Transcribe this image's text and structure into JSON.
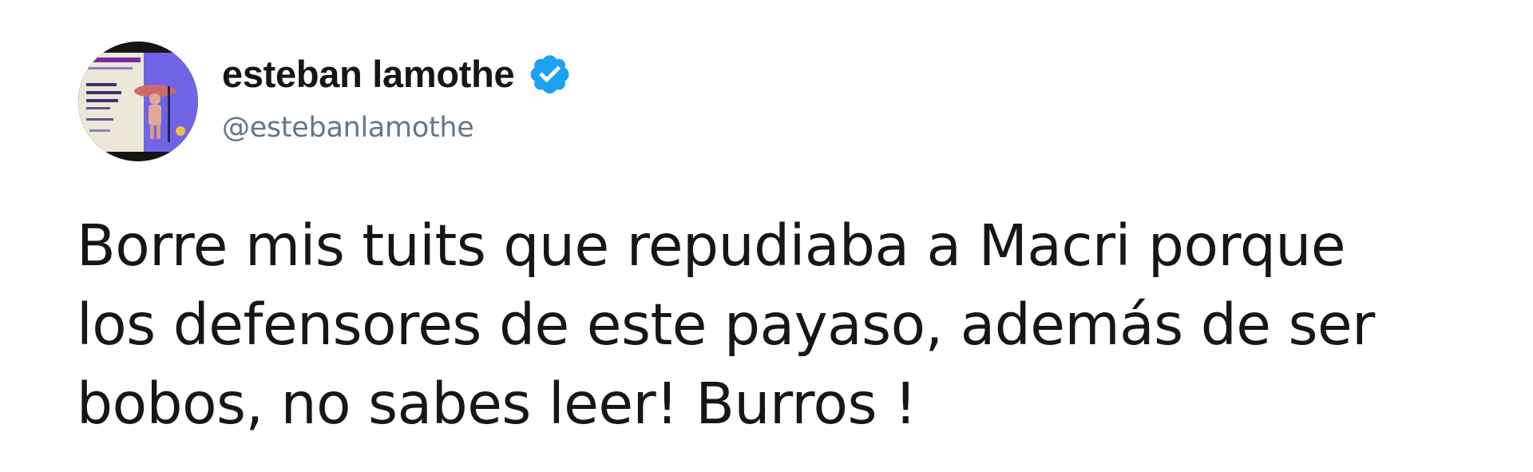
{
  "tweet": {
    "author": {
      "display_name": "esteban lamothe",
      "handle": "@estebanlamothe",
      "verified_icon": "verified-badge-icon",
      "avatar_icon": "profile-photo-avatar"
    },
    "text_lines": [
      "Borre mis tuits que repudiaba a Macri porque",
      "los defensores de este payaso, además de ser",
      "bobos, no sabes leer! Burros !"
    ]
  },
  "colors": {
    "text": "#14171a",
    "handle": "#657786",
    "verified": "#1da1f2",
    "avatar_accent": "#6b5fe0"
  }
}
